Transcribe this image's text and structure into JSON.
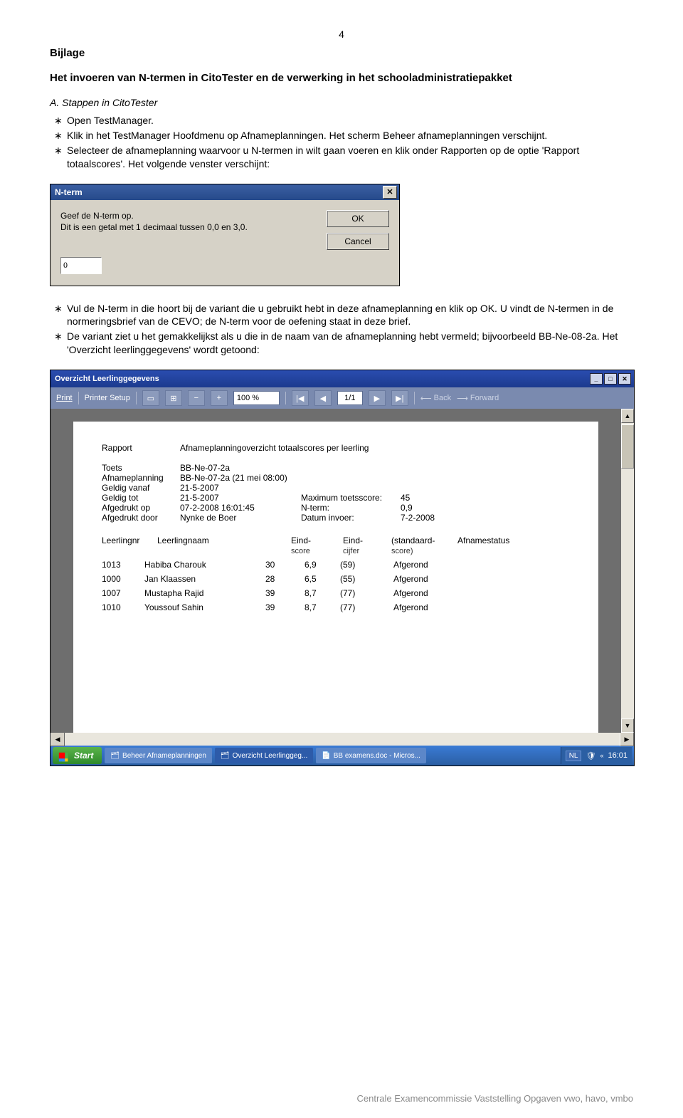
{
  "page_number": "4",
  "appendix_label": "Bijlage",
  "doc_title": "Het invoeren van N-termen in CitoTester en de verwerking in het schooladministratiepakket",
  "section_a": "A.  Stappen in CitoTester",
  "bullets_a": [
    "Open TestManager.",
    "Klik in het TestManager Hoofdmenu op Afnameplanningen. Het scherm Beheer afnameplanningen verschijnt.",
    "Selecteer de afnameplanning waarvoor u N-termen in wilt gaan voeren en klik onder Rapporten op de optie 'Rapport totaalscores'. Het volgende venster verschijnt:"
  ],
  "bullets_a_italic_words": {
    "2": "Rapporten"
  },
  "nterm_dialog": {
    "title": "N-term",
    "line1": "Geef de N-term op.",
    "line2": "Dit is een getal met 1 decimaal tussen 0,0 en 3,0.",
    "ok": "OK",
    "cancel": "Cancel",
    "value": "0"
  },
  "bullets_b": [
    "Vul de N-term in die hoort bij de variant die u gebruikt hebt in deze afnameplanning en klik op OK. U vindt de N-termen in de normeringsbrief van de CEVO; de N-term voor de oefening staat in deze brief.",
    "De variant ziet u het gemakkelijkst als u die in de naam van de afnameplanning hebt vermeld; bijvoorbeeld BB-Ne-08-2a. Het 'Overzicht leerlinggegevens' wordt getoond:"
  ],
  "bullets_b_italic_words": {
    "1": "Overzicht leerlinggegevens"
  },
  "report_window": {
    "title": "Overzicht Leerlinggegevens",
    "toolbar": {
      "print": "Print",
      "printer_setup": "Printer Setup",
      "zoom": "100 %",
      "page": "1/1",
      "back": "Back",
      "forward": "Forward"
    },
    "paper": {
      "rapport_label": "Rapport",
      "rapport_value": "Afnameplanningoverzicht totaalscores per leerling",
      "fields_left": [
        {
          "k": "Toets",
          "v": "BB-Ne-07-2a"
        },
        {
          "k": "Afnameplanning",
          "v": "BB-Ne-07-2a (21 mei 08:00)"
        },
        {
          "k": "Geldig vanaf",
          "v": "21-5-2007"
        },
        {
          "k": "Geldig tot",
          "v": "21-5-2007"
        },
        {
          "k": "Afgedrukt op",
          "v": "07-2-2008 16:01:45"
        },
        {
          "k": "Afgedrukt door",
          "v": "Nynke de Boer"
        }
      ],
      "fields_right": [
        {
          "k": "Maximum toetsscore:",
          "v": "45"
        },
        {
          "k": "N-term:",
          "v": "0,9"
        },
        {
          "k": "Datum invoer:",
          "v": "7-2-2008"
        }
      ],
      "col_headers": {
        "nr": "Leerlingnr",
        "name": "Leerlingnaam",
        "eind_score": "Eind-",
        "eind_score2": "score",
        "eind_cijfer": "Eind-",
        "eind_cijfer2": "cijfer",
        "std": "(standaard-",
        "std2": "score)",
        "status": "Afnamestatus"
      },
      "rows": [
        {
          "nr": "1013",
          "name": "Habiba Charouk",
          "score": "30",
          "cijfer": "6,9",
          "std": "(59)",
          "status": "Afgerond"
        },
        {
          "nr": "1000",
          "name": "Jan Klaassen",
          "score": "28",
          "cijfer": "6,5",
          "std": "(55)",
          "status": "Afgerond"
        },
        {
          "nr": "1007",
          "name": "Mustapha Rajid",
          "score": "39",
          "cijfer": "8,7",
          "std": "(77)",
          "status": "Afgerond"
        },
        {
          "nr": "1010",
          "name": "Youssouf Sahin",
          "score": "39",
          "cijfer": "8,7",
          "std": "(77)",
          "status": "Afgerond"
        }
      ]
    },
    "taskbar": {
      "start": "Start",
      "tasks": [
        "Beheer Afnameplanningen",
        "Overzicht Leerlinggeg...",
        "BB examens.doc - Micros..."
      ],
      "lang": "NL",
      "time": "16:01"
    }
  },
  "footer": "Centrale Examencommissie Vaststelling Opgaven vwo, havo, vmbo"
}
